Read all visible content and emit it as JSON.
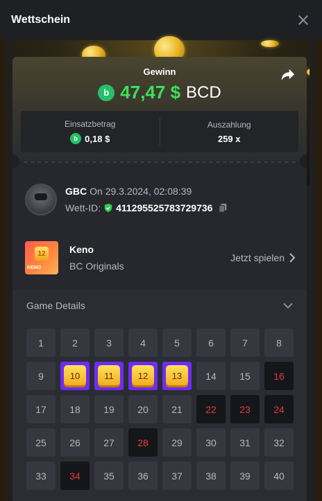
{
  "header": {
    "title": "Wettschein"
  },
  "win": {
    "label": "Gewinn",
    "amount": "47,47 $",
    "currency": "BCD",
    "coin_symbol": "b"
  },
  "stats": {
    "stake_label": "Einsatzbetrag",
    "stake_value": "0,18 $",
    "payout_label": "Auszahlung",
    "payout_value": "259 x"
  },
  "user": {
    "name": "GBC",
    "on_text": "On 29.3.2024, 02:08:39",
    "bet_id_label": "Wett-ID:",
    "bet_id": "411295525783729736"
  },
  "game": {
    "name": "Keno",
    "provider": "BC Originals",
    "play_label": "Jetzt spielen",
    "thumb_label": "KENO",
    "thumb_number": "12"
  },
  "details": {
    "title": "Game Details"
  },
  "keno": {
    "numbers": [
      "1",
      "2",
      "3",
      "4",
      "5",
      "6",
      "7",
      "8",
      "9",
      "10",
      "11",
      "12",
      "13",
      "14",
      "15",
      "16",
      "17",
      "18",
      "19",
      "20",
      "21",
      "22",
      "23",
      "24",
      "25",
      "26",
      "27",
      "28",
      "29",
      "30",
      "31",
      "32",
      "33",
      "34",
      "35",
      "36",
      "37",
      "38",
      "39",
      "40"
    ],
    "picked": [
      "10",
      "11",
      "12",
      "13"
    ],
    "drawn": [
      "16",
      "22",
      "23",
      "24",
      "28",
      "34"
    ]
  },
  "colors": {
    "win_green": "#3ce05a",
    "pick_purple": "#6e2cf5",
    "drawn_red": "#e03a3a"
  },
  "icons": [
    "close-icon",
    "share-icon",
    "bc-coin-icon",
    "verified-shield-icon",
    "copy-icon",
    "chevron-right-icon",
    "chevron-down-icon"
  ]
}
